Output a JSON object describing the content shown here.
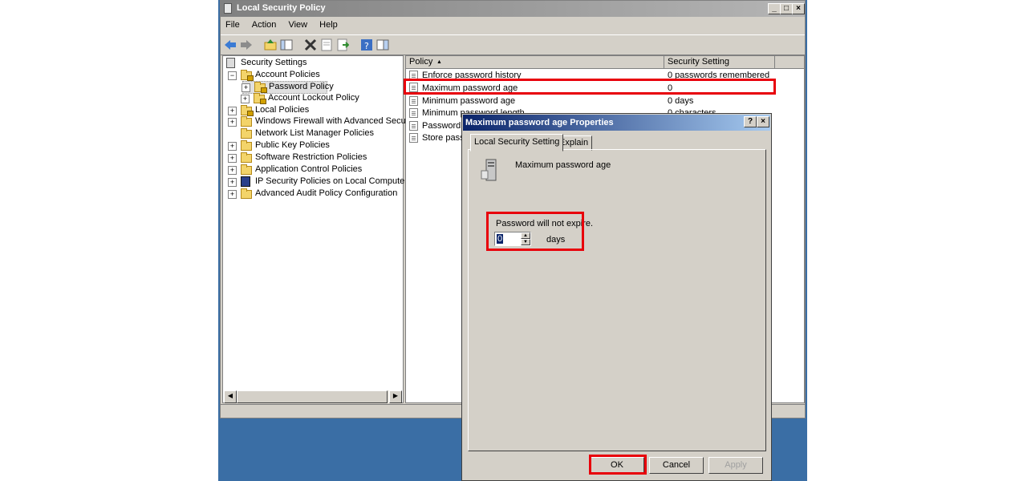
{
  "window": {
    "title": "Local Security Policy",
    "buttons": {
      "minimize": "_",
      "maximize": "□",
      "close": "×"
    }
  },
  "menu": [
    "File",
    "Action",
    "View",
    "Help"
  ],
  "tree": [
    {
      "label": "Security Settings",
      "icon": "security-settings-icon"
    },
    {
      "label": "Account Policies",
      "icon": "locked-folder-icon",
      "expander": "−"
    },
    {
      "label": "Password Policy",
      "icon": "locked-folder-icon",
      "expander": "+",
      "selected": true
    },
    {
      "label": "Account Lockout Policy",
      "icon": "locked-folder-icon",
      "expander": "+"
    },
    {
      "label": "Local Policies",
      "icon": "locked-folder-icon",
      "expander": "+"
    },
    {
      "label": "Windows Firewall with Advanced Security",
      "icon": "folder-icon",
      "expander": "+"
    },
    {
      "label": "Network List Manager Policies",
      "icon": "folder-icon"
    },
    {
      "label": "Public Key Policies",
      "icon": "folder-icon",
      "expander": "+"
    },
    {
      "label": "Software Restriction Policies",
      "icon": "folder-icon",
      "expander": "+"
    },
    {
      "label": "Application Control Policies",
      "icon": "folder-icon",
      "expander": "+"
    },
    {
      "label": "IP Security Policies on Local Computer",
      "icon": "ip-security-icon",
      "expander": "+"
    },
    {
      "label": "Advanced Audit Policy Configuration",
      "icon": "folder-icon",
      "expander": "+"
    }
  ],
  "list": {
    "headers": {
      "policy": "Policy",
      "setting": "Security Setting"
    },
    "rows": [
      {
        "policy": "Enforce password history",
        "setting": "0 passwords remembered"
      },
      {
        "policy": "Maximum password age",
        "setting": "0"
      },
      {
        "policy": "Minimum password age",
        "setting": "0 days"
      },
      {
        "policy": "Minimum password length",
        "setting": "0 characters"
      },
      {
        "policy": "Password m",
        "setting": ""
      },
      {
        "policy": "Store passw",
        "setting": ""
      }
    ]
  },
  "dialog": {
    "title": "Maximum password age Properties",
    "help": "?",
    "close": "×",
    "tabs": [
      "Local Security Setting",
      "Explain"
    ],
    "heading": "Maximum password age",
    "note": "Password will not expire.",
    "days_value": "0",
    "days_unit": "days",
    "buttons": {
      "ok": "OK",
      "cancel": "Cancel",
      "apply": "Apply"
    }
  },
  "colors": {
    "highlight": "#e8000b",
    "desktop": "#3a6ea5"
  }
}
